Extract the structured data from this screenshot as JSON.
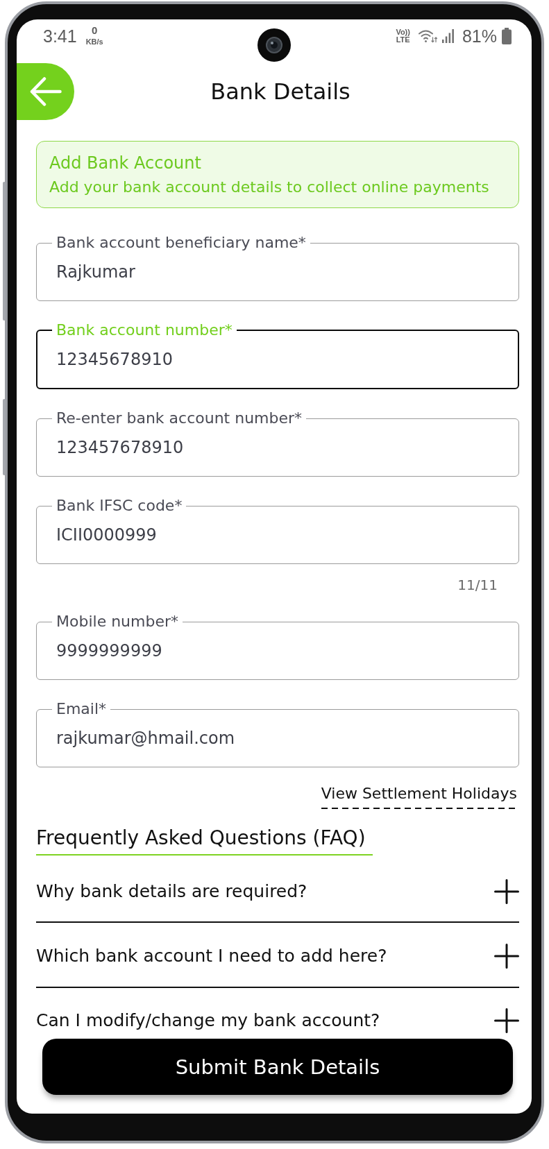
{
  "status_bar": {
    "time": "3:41",
    "net_speed": "0",
    "net_speed_unit": "KB/s",
    "volte_top": "Vo))",
    "volte_bottom": "LTE",
    "battery": "81%"
  },
  "header": {
    "title": "Bank Details"
  },
  "banner": {
    "title": "Add Bank Account",
    "text": "Add your bank account details to collect online payments"
  },
  "fields": [
    {
      "label": "Bank account beneficiary name*",
      "value": "Rajkumar",
      "focused": false
    },
    {
      "label": "Bank account number*",
      "value": "12345678910",
      "focused": true
    },
    {
      "label": "Re-enter bank account number*",
      "value": "123457678910",
      "focused": false
    },
    {
      "label": "Bank IFSC code*",
      "value": "ICII0000999",
      "focused": false,
      "counter": "11/11"
    },
    {
      "label": "Mobile number*",
      "value": "9999999999",
      "focused": false
    },
    {
      "label": "Email*",
      "value": "rajkumar@hmail.com",
      "focused": false
    }
  ],
  "settlement_link": "View Settlement Holidays",
  "faq": {
    "title": "Frequently Asked Questions (FAQ)",
    "items": [
      {
        "question": "Why bank details are required?",
        "expanded": false
      },
      {
        "question": "Which bank account I need to add here?",
        "expanded": false
      },
      {
        "question": "Can I modify/change my bank account?",
        "expanded": false
      }
    ]
  },
  "submit_button": "Submit Bank Details"
}
